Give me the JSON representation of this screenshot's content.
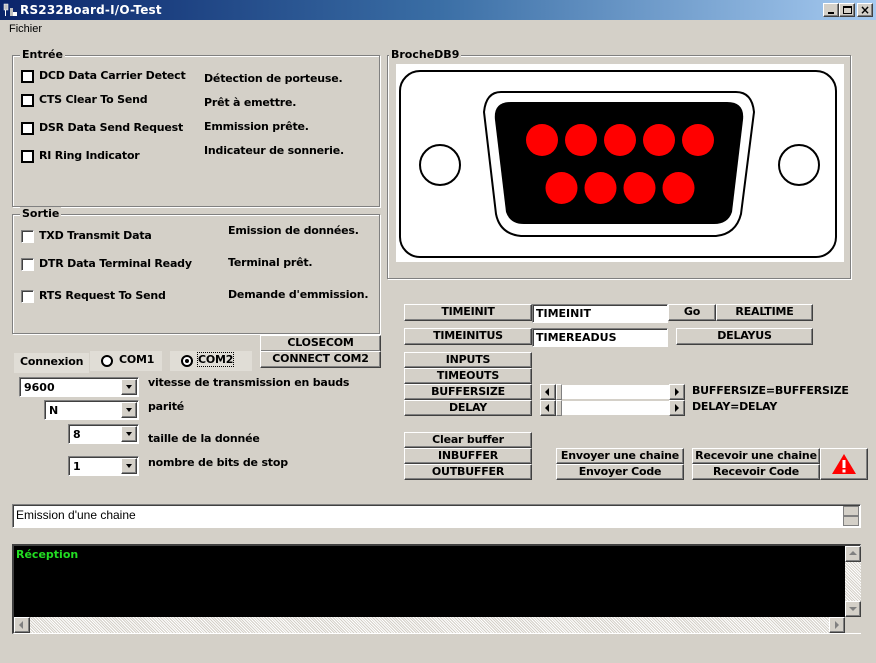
{
  "window": {
    "title": "RS232Board-I/O-Test",
    "controls": {
      "minimize": "_",
      "maximize": "□",
      "close": "×"
    }
  },
  "menu": {
    "items": [
      "Fichier"
    ]
  },
  "entree": {
    "legend": "Entrée",
    "items": [
      {
        "label": "DCD Data Carrier Detect",
        "description": "Détection de porteuse.",
        "checked": false
      },
      {
        "label": "CTS Clear To Send",
        "description": "Prêt à emettre.",
        "checked": false
      },
      {
        "label": "DSR  Data Send Request",
        "description": "Emmission prête.",
        "checked": false
      },
      {
        "label": "RI Ring Indicator",
        "description": "Indicateur de sonnerie.",
        "checked": false
      }
    ]
  },
  "sortie": {
    "legend": "Sortie",
    "items": [
      {
        "label": "TXD Transmit Data",
        "description": "Emission de données.",
        "checked": false
      },
      {
        "label": "DTR  Data Terminal Ready",
        "description": "Terminal prêt.",
        "checked": false
      },
      {
        "label": "RTS Request To Send",
        "description": "Demande d'emmission.",
        "checked": false
      }
    ]
  },
  "broche": {
    "legend": "BrocheDB9",
    "pins_top_row": 5,
    "pins_bottom_row": 4,
    "pin_color": "#ff0000"
  },
  "connexion": {
    "label": "Connexion",
    "options": [
      "COM1",
      "COM2"
    ],
    "selected": "COM2",
    "closecom_label": "CLOSECOM",
    "connect_label": "CONNECT COM2"
  },
  "settings": [
    {
      "value": "9600",
      "label": "vitesse de transmission en bauds"
    },
    {
      "value": "N",
      "label": "parité"
    },
    {
      "value": "8",
      "label": "taille de la donnée"
    },
    {
      "value": "1",
      "label": "nombre de bits de stop"
    }
  ],
  "timing": {
    "timeinit_button": "TIMEINIT",
    "timeinit_value": "TIMEINIT",
    "go_button": "Go",
    "realtime_button": "REALTIME",
    "timeinitus_button": "TIMEINITUS",
    "timereadus_value": "TIMEREADUS",
    "delayus_button": "DELAYUS"
  },
  "controls": {
    "inputs": "INPUTS",
    "timeouts": "TIMEOUTS",
    "buffersize": "BUFFERSIZE",
    "delay": "DELAY",
    "buffersize_readout": "BUFFERSIZE=BUFFERSIZE",
    "delay_readout": "DELAY=DELAY"
  },
  "buffer": {
    "clear": "Clear buffer",
    "inbuffer": "INBUFFER",
    "outbuffer": "OUTBUFFER"
  },
  "transfer": {
    "send_string": "Envoyer une chaine",
    "send_code": "Envoyer Code",
    "receive_string": "Recevoir une chaine",
    "receive_code": "Recevoir Code",
    "alert_icon": "warning-triangle"
  },
  "emission": {
    "text": "Emission d'une chaine"
  },
  "reception": {
    "text": "Réception",
    "text_color": "#22dd22"
  }
}
